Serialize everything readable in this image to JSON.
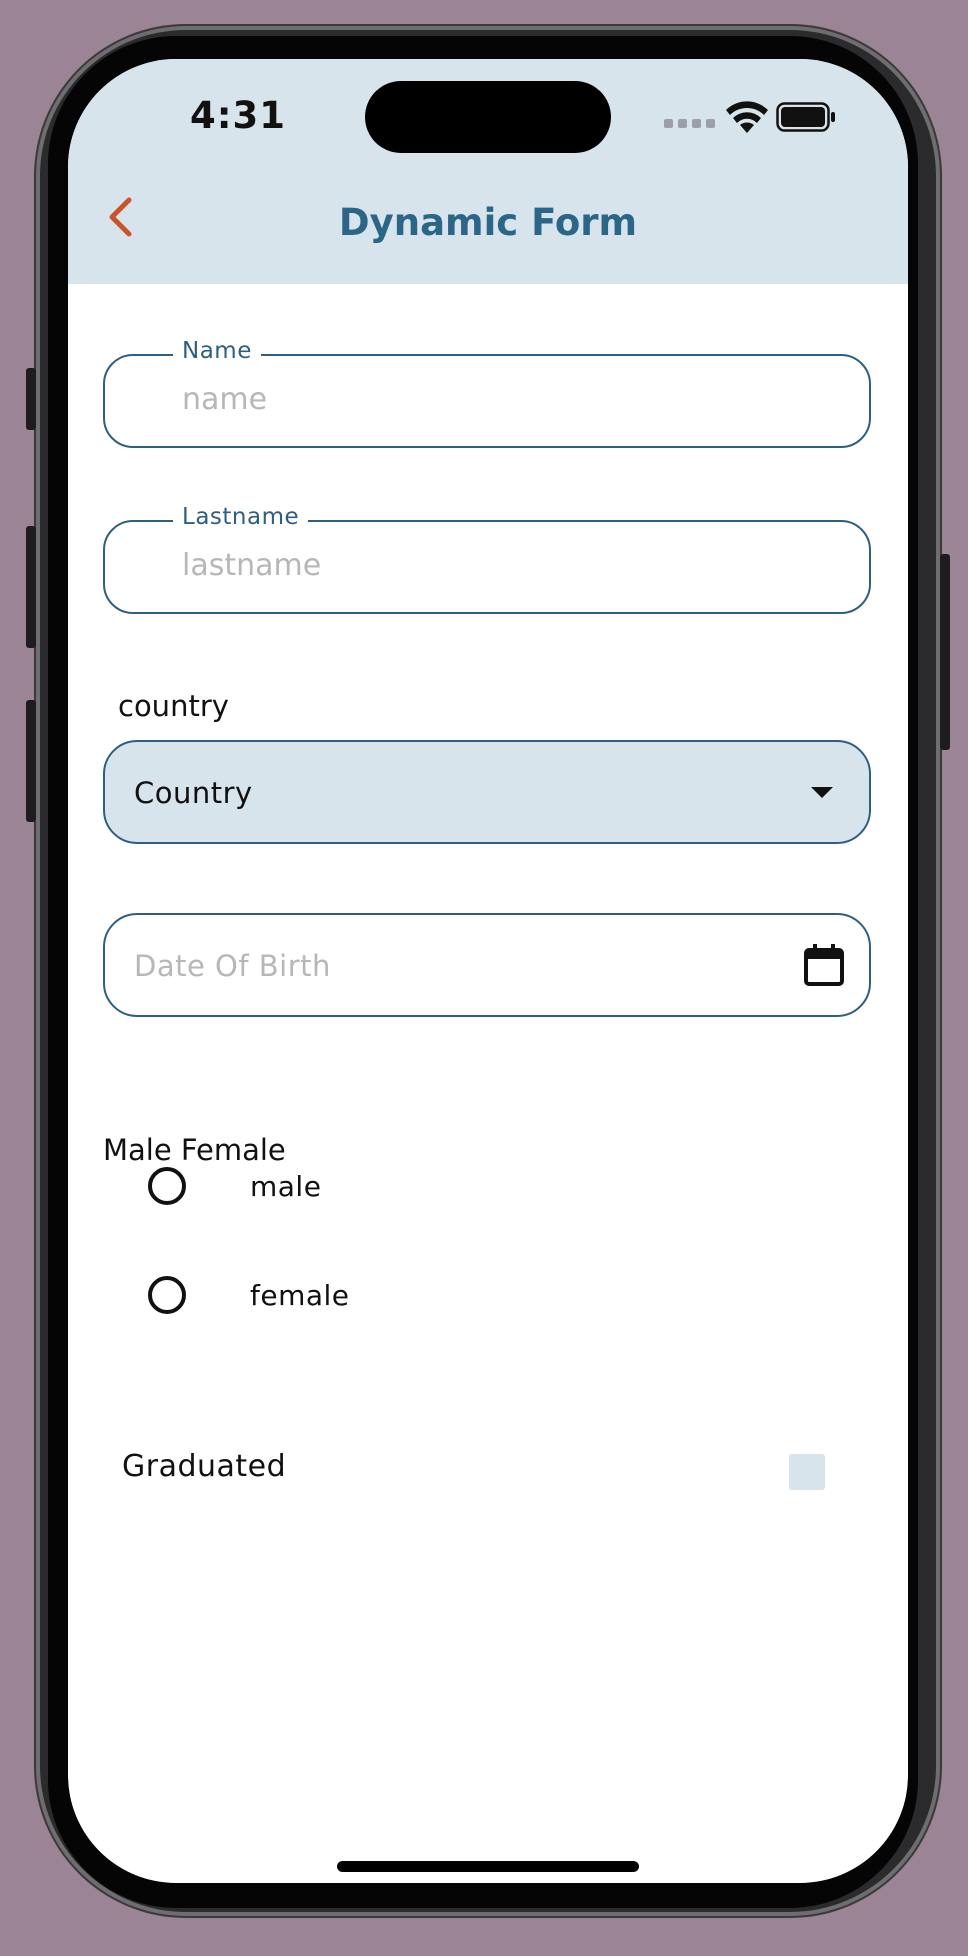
{
  "status_bar": {
    "time": "4:31"
  },
  "header": {
    "title": "Dynamic Form",
    "back_icon": "chevron-left-icon",
    "accent_color": "#c9542b",
    "title_color": "#2b6588"
  },
  "form": {
    "name": {
      "label": "Name",
      "placeholder": "name"
    },
    "lastname": {
      "label": "Lastname",
      "placeholder": "lastname"
    },
    "country": {
      "section_label": "country",
      "selected": "Country"
    },
    "date_of_birth": {
      "placeholder": "Date Of Birth",
      "icon": "calendar-icon"
    },
    "gender": {
      "section_label": "Male Female",
      "options": [
        {
          "label": "male",
          "selected": false
        },
        {
          "label": "female",
          "selected": false
        }
      ]
    },
    "graduated": {
      "label": "Graduated",
      "checked": false
    }
  },
  "colors": {
    "header_bg": "#d7e4ec",
    "border": "#2f5f80",
    "placeholder": "#b7b7b7"
  }
}
